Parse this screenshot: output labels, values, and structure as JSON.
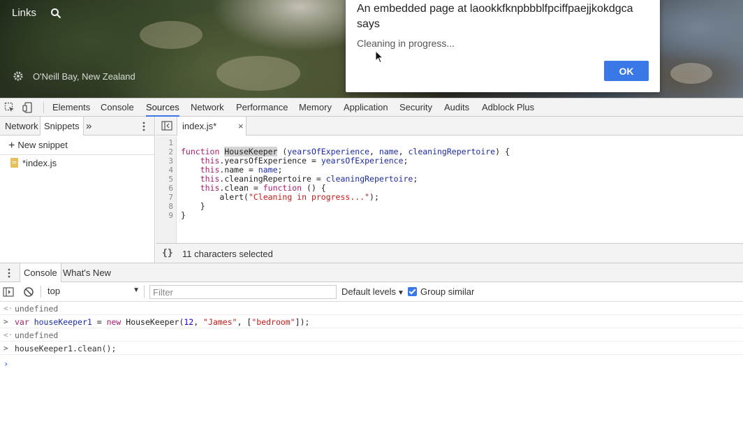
{
  "page": {
    "links_label": "Links",
    "location_label": "O'Neill Bay, New Zealand"
  },
  "alert": {
    "title": "An embedded page at laookkfknpbbblfpciffpaejjkokdgca says",
    "message": "Cleaning in progress...",
    "ok_label": "OK"
  },
  "devtools": {
    "main_tabs": [
      "Elements",
      "Console",
      "Sources",
      "Network",
      "Performance",
      "Memory",
      "Application",
      "Security",
      "Audits",
      "Adblock Plus"
    ],
    "active_main_tab": "Sources",
    "navigator": {
      "tabs": [
        "Network",
        "Snippets"
      ],
      "active_tab": "Snippets",
      "more_label": "»",
      "new_snippet_label": "New snippet",
      "files": [
        "*index.js"
      ]
    },
    "editor": {
      "tab_label": "index.js*",
      "close_glyph": "×",
      "line_numbers": [
        "1",
        "2",
        "3",
        "4",
        "5",
        "6",
        "7",
        "8",
        "9"
      ],
      "status_text": "11 characters selected",
      "pretty_print_label": "{}"
    },
    "drawer": {
      "tabs": [
        "Console",
        "What's New"
      ],
      "active_tab": "Console",
      "context_label": "top",
      "filter_placeholder": "Filter",
      "levels_label": "Default levels",
      "group_similar_label": "Group similar",
      "group_similar_checked": true,
      "messages": [
        {
          "type": "result",
          "text": "undefined"
        },
        {
          "type": "input",
          "text": "var houseKeeper1 = new HouseKeeper(12, \"James\", [\"bedroom\"]);"
        },
        {
          "type": "result",
          "text": "undefined"
        },
        {
          "type": "input",
          "text": "houseKeeper1.clean();"
        }
      ]
    }
  },
  "colors": {
    "accent": "#3b78e7",
    "keyword": "#a51d6b",
    "string": "#c41a16",
    "variable": "#1c2aa6"
  }
}
